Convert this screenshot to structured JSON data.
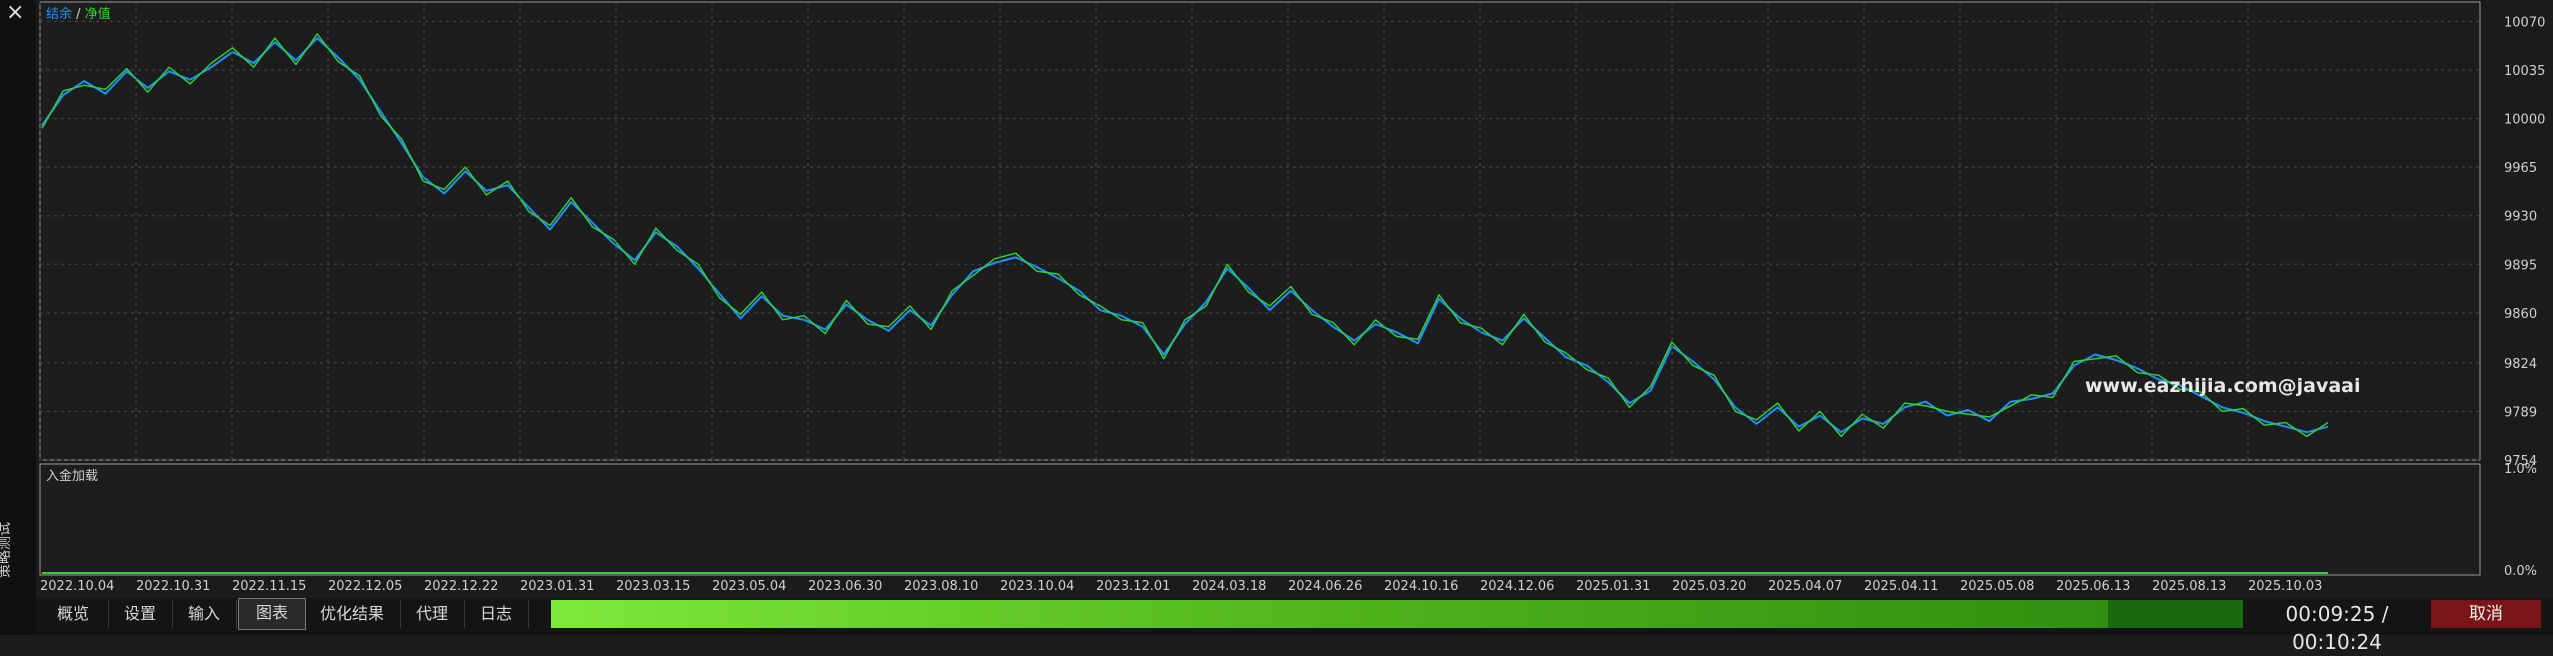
{
  "window": {
    "close_symbol": "×",
    "side_label": "策略测试"
  },
  "chart_data": {
    "type": "line",
    "legend": {
      "balance": "结余",
      "separator": " / ",
      "equity": "净值"
    },
    "colors": {
      "balance": "#1e90ff",
      "equity": "#32cd32",
      "grid": "#4a4a4a",
      "background": "#1b1b1b"
    },
    "y_ticks": [
      10070,
      10035,
      10000,
      9965,
      9930,
      9895,
      9860,
      9824,
      9789,
      9754
    ],
    "ylim": [
      9754,
      10084
    ],
    "x_ticks": [
      "2022.10.04",
      "2022.10.31",
      "2022.11.15",
      "2022.12.05",
      "2022.12.22",
      "2023.01.31",
      "2023.03.15",
      "2023.05.04",
      "2023.06.30",
      "2023.08.10",
      "2023.10.04",
      "2023.12.01",
      "2024.03.18",
      "2024.06.26",
      "2024.10.16",
      "2024.12.06",
      "2025.01.31",
      "2025.03.20",
      "2025.04.07",
      "2025.04.11",
      "2025.05.08",
      "2025.06.13",
      "2025.08.13",
      "2025.10.03"
    ],
    "series": [
      {
        "name": "结余",
        "points": [
          [
            0,
            9995
          ],
          [
            0.02,
            10017
          ],
          [
            0.04,
            10027
          ],
          [
            0.06,
            10018
          ],
          [
            0.08,
            10034
          ],
          [
            0.1,
            10022
          ],
          [
            0.12,
            10034
          ],
          [
            0.14,
            10028
          ],
          [
            0.16,
            10037
          ],
          [
            0.18,
            10048
          ],
          [
            0.2,
            10040
          ],
          [
            0.22,
            10055
          ],
          [
            0.24,
            10042
          ],
          [
            0.26,
            10058
          ],
          [
            0.28,
            10044
          ],
          [
            0.3,
            10028
          ],
          [
            0.32,
            10005
          ],
          [
            0.34,
            9982
          ],
          [
            0.36,
            9958
          ],
          [
            0.38,
            9946
          ],
          [
            0.4,
            9962
          ],
          [
            0.42,
            9948
          ],
          [
            0.44,
            9952
          ],
          [
            0.46,
            9936
          ],
          [
            0.48,
            9920
          ],
          [
            0.5,
            9940
          ],
          [
            0.52,
            9925
          ],
          [
            0.54,
            9910
          ],
          [
            0.56,
            9898
          ],
          [
            0.58,
            9918
          ],
          [
            0.6,
            9908
          ],
          [
            0.62,
            9892
          ],
          [
            0.64,
            9874
          ],
          [
            0.66,
            9856
          ],
          [
            0.68,
            9872
          ],
          [
            0.7,
            9858
          ],
          [
            0.72,
            9855
          ],
          [
            0.74,
            9848
          ],
          [
            0.76,
            9866
          ],
          [
            0.78,
            9855
          ],
          [
            0.8,
            9847
          ],
          [
            0.82,
            9862
          ],
          [
            0.84,
            9851
          ],
          [
            0.86,
            9873
          ],
          [
            0.88,
            9890
          ],
          [
            0.9,
            9896
          ],
          [
            0.92,
            9900
          ],
          [
            0.94,
            9893
          ],
          [
            0.96,
            9885
          ],
          [
            0.98,
            9876
          ],
          [
            1.0,
            9862
          ],
          [
            1.02,
            9858
          ],
          [
            1.04,
            9850
          ],
          [
            1.06,
            9830
          ],
          [
            1.08,
            9852
          ],
          [
            1.1,
            9868
          ],
          [
            1.12,
            9892
          ],
          [
            1.14,
            9878
          ],
          [
            1.16,
            9862
          ],
          [
            1.18,
            9876
          ],
          [
            1.2,
            9862
          ],
          [
            1.22,
            9850
          ],
          [
            1.24,
            9840
          ],
          [
            1.26,
            9852
          ],
          [
            1.28,
            9846
          ],
          [
            1.3,
            9838
          ],
          [
            1.32,
            9870
          ],
          [
            1.34,
            9856
          ],
          [
            1.36,
            9846
          ],
          [
            1.38,
            9840
          ],
          [
            1.4,
            9856
          ],
          [
            1.42,
            9842
          ],
          [
            1.44,
            9828
          ],
          [
            1.46,
            9822
          ],
          [
            1.48,
            9810
          ],
          [
            1.5,
            9795
          ],
          [
            1.52,
            9804
          ],
          [
            1.54,
            9836
          ],
          [
            1.56,
            9825
          ],
          [
            1.58,
            9812
          ],
          [
            1.6,
            9792
          ],
          [
            1.62,
            9780
          ],
          [
            1.64,
            9792
          ],
          [
            1.66,
            9778
          ],
          [
            1.68,
            9786
          ],
          [
            1.7,
            9774
          ],
          [
            1.72,
            9784
          ],
          [
            1.74,
            9780
          ],
          [
            1.76,
            9792
          ],
          [
            1.78,
            9796
          ],
          [
            1.8,
            9786
          ],
          [
            1.82,
            9790
          ],
          [
            1.84,
            9782
          ],
          [
            1.86,
            9796
          ],
          [
            1.88,
            9798
          ],
          [
            1.9,
            9802
          ],
          [
            1.92,
            9822
          ],
          [
            1.94,
            9830
          ],
          [
            1.96,
            9826
          ],
          [
            1.98,
            9820
          ],
          [
            2.0,
            9812
          ],
          [
            2.02,
            9808
          ],
          [
            2.04,
            9800
          ],
          [
            2.06,
            9792
          ],
          [
            2.08,
            9788
          ],
          [
            2.1,
            9782
          ],
          [
            2.12,
            9778
          ],
          [
            2.14,
            9774
          ],
          [
            2.16,
            9778
          ]
        ]
      },
      {
        "name": "净值",
        "points": [
          [
            0,
            9993
          ],
          [
            0.02,
            10020
          ],
          [
            0.04,
            10024
          ],
          [
            0.06,
            10021
          ],
          [
            0.08,
            10036
          ],
          [
            0.1,
            10019
          ],
          [
            0.12,
            10037
          ],
          [
            0.14,
            10025
          ],
          [
            0.16,
            10040
          ],
          [
            0.18,
            10051
          ],
          [
            0.2,
            10037
          ],
          [
            0.22,
            10058
          ],
          [
            0.24,
            10039
          ],
          [
            0.26,
            10061
          ],
          [
            0.28,
            10041
          ],
          [
            0.3,
            10031
          ],
          [
            0.32,
            10002
          ],
          [
            0.34,
            9985
          ],
          [
            0.36,
            9955
          ],
          [
            0.38,
            9949
          ],
          [
            0.4,
            9965
          ],
          [
            0.42,
            9945
          ],
          [
            0.44,
            9955
          ],
          [
            0.46,
            9933
          ],
          [
            0.48,
            9923
          ],
          [
            0.5,
            9943
          ],
          [
            0.52,
            9922
          ],
          [
            0.54,
            9913
          ],
          [
            0.56,
            9895
          ],
          [
            0.58,
            9921
          ],
          [
            0.6,
            9905
          ],
          [
            0.62,
            9895
          ],
          [
            0.64,
            9871
          ],
          [
            0.66,
            9859
          ],
          [
            0.68,
            9875
          ],
          [
            0.7,
            9855
          ],
          [
            0.72,
            9858
          ],
          [
            0.74,
            9845
          ],
          [
            0.76,
            9869
          ],
          [
            0.78,
            9852
          ],
          [
            0.8,
            9850
          ],
          [
            0.82,
            9865
          ],
          [
            0.84,
            9848
          ],
          [
            0.86,
            9876
          ],
          [
            0.88,
            9887
          ],
          [
            0.9,
            9899
          ],
          [
            0.92,
            9903
          ],
          [
            0.94,
            9890
          ],
          [
            0.96,
            9888
          ],
          [
            0.98,
            9873
          ],
          [
            1.0,
            9865
          ],
          [
            1.02,
            9855
          ],
          [
            1.04,
            9853
          ],
          [
            1.06,
            9827
          ],
          [
            1.08,
            9855
          ],
          [
            1.1,
            9865
          ],
          [
            1.12,
            9895
          ],
          [
            1.14,
            9875
          ],
          [
            1.16,
            9865
          ],
          [
            1.18,
            9879
          ],
          [
            1.2,
            9859
          ],
          [
            1.22,
            9853
          ],
          [
            1.24,
            9837
          ],
          [
            1.26,
            9855
          ],
          [
            1.28,
            9843
          ],
          [
            1.3,
            9841
          ],
          [
            1.32,
            9873
          ],
          [
            1.34,
            9853
          ],
          [
            1.36,
            9849
          ],
          [
            1.38,
            9837
          ],
          [
            1.4,
            9859
          ],
          [
            1.42,
            9839
          ],
          [
            1.44,
            9831
          ],
          [
            1.46,
            9819
          ],
          [
            1.48,
            9813
          ],
          [
            1.5,
            9792
          ],
          [
            1.52,
            9807
          ],
          [
            1.54,
            9839
          ],
          [
            1.56,
            9822
          ],
          [
            1.58,
            9815
          ],
          [
            1.6,
            9789
          ],
          [
            1.62,
            9783
          ],
          [
            1.64,
            9795
          ],
          [
            1.66,
            9775
          ],
          [
            1.68,
            9789
          ],
          [
            1.7,
            9771
          ],
          [
            1.72,
            9787
          ],
          [
            1.74,
            9777
          ],
          [
            1.76,
            9795
          ],
          [
            1.78,
            9793
          ],
          [
            1.8,
            9789
          ],
          [
            1.82,
            9787
          ],
          [
            1.84,
            9785
          ],
          [
            1.86,
            9793
          ],
          [
            1.88,
            9801
          ],
          [
            1.9,
            9799
          ],
          [
            1.92,
            9825
          ],
          [
            1.94,
            9827
          ],
          [
            1.96,
            9829
          ],
          [
            1.98,
            9817
          ],
          [
            2.0,
            9815
          ],
          [
            2.02,
            9805
          ],
          [
            2.04,
            9803
          ],
          [
            2.06,
            9789
          ],
          [
            2.08,
            9791
          ],
          [
            2.1,
            9779
          ],
          [
            2.12,
            9781
          ],
          [
            2.14,
            9771
          ],
          [
            2.16,
            9781
          ]
        ]
      }
    ],
    "watermark": "www.eazhijia.com@javaai"
  },
  "deposit_chart": {
    "title": "入金加载",
    "y_ticks": [
      "1.0%",
      "0.0%"
    ]
  },
  "tabs": [
    {
      "label": "概览",
      "active": false
    },
    {
      "label": "设置",
      "active": false
    },
    {
      "label": "输入",
      "active": false
    },
    {
      "label": "图表",
      "active": true
    },
    {
      "label": "优化结果",
      "active": false
    },
    {
      "label": "代理",
      "active": false
    },
    {
      "label": "日志",
      "active": false
    }
  ],
  "progress": {
    "fraction": 0.92
  },
  "timer": "00:09:25 / 00:10:24",
  "cancel_label": "取消"
}
